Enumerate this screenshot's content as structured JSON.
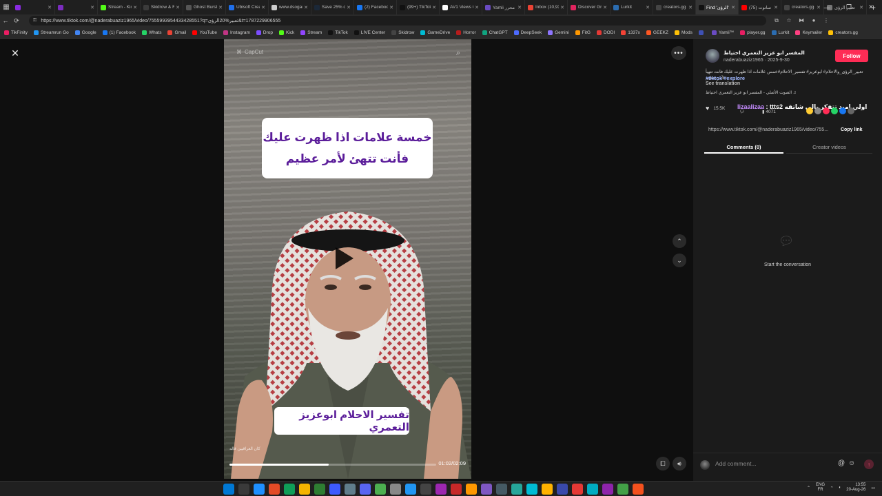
{
  "browser": {
    "tabs": [
      {
        "label": "",
        "color": "#8a2be2"
      },
      {
        "label": "",
        "color": "#7b2cbf"
      },
      {
        "label": "Stream - Kick",
        "color": "#53fc18"
      },
      {
        "label": "Skidrow & Re",
        "color": "#3b3b3b"
      },
      {
        "label": "Ghost Bursts",
        "color": "#555555"
      },
      {
        "label": "Ubisoft Crea",
        "color": "#1f6feb"
      },
      {
        "label": "www.dsogam",
        "color": "#cccccc"
      },
      {
        "label": "Save 25% on",
        "color": "#1b2838"
      },
      {
        "label": "(2) Facebook",
        "color": "#1877f2"
      },
      {
        "label": "(99+) TikTok",
        "color": "#111111"
      },
      {
        "label": "AV1 Views C",
        "color": "#ffffff"
      },
      {
        "label": "Yamli محرر",
        "color": "#6a4bc2"
      },
      {
        "label": "Inbox (10,93",
        "color": "#ea4335"
      },
      {
        "label": "Discover Gr",
        "color": "#e0245e"
      },
      {
        "label": "Lurkit",
        "color": "#2b6cb0"
      },
      {
        "label": "creators.gg",
        "color": "#444444"
      },
      {
        "label": "Find 'الرؤى'",
        "color": "#111111"
      },
      {
        "label": "(75) ساتوت",
        "color": "#ff0000"
      },
      {
        "label": "creators.gg",
        "color": "#444444"
      },
      {
        "label": "تعبير الرؤى",
        "color": "#777777"
      }
    ],
    "active_tab_index": 16,
    "url": "https://www.tiktok.com/@naderabuaziz1965/video/7555993954433428551?q=تعبير%20الرؤى&t=1787229906555",
    "bookmarks": [
      {
        "label": "TikFinity",
        "color": "#e91e63"
      },
      {
        "label": "Streamrun Go",
        "color": "#2196f3"
      },
      {
        "label": "Google",
        "color": "#4285f4"
      },
      {
        "label": "(1) Facebook",
        "color": "#1877f2"
      },
      {
        "label": "Whats",
        "color": "#25d366"
      },
      {
        "label": "Gmail",
        "color": "#ea4335"
      },
      {
        "label": "YouTube",
        "color": "#ff0000"
      },
      {
        "label": "Instagram",
        "color": "#c13584"
      },
      {
        "label": "Drop",
        "color": "#7c4dff"
      },
      {
        "label": "Kick",
        "color": "#53fc18"
      },
      {
        "label": "Stream",
        "color": "#9146ff"
      },
      {
        "label": "TikTok",
        "color": "#111111"
      },
      {
        "label": "LIVE Center",
        "color": "#111111"
      },
      {
        "label": "Skidrow",
        "color": "#444444"
      },
      {
        "label": "GameDrive",
        "color": "#00bcd4"
      },
      {
        "label": "Horror",
        "color": "#b71c1c"
      },
      {
        "label": "ChatGPT",
        "color": "#10a37f"
      },
      {
        "label": "DeepSeek",
        "color": "#4d6bfe"
      },
      {
        "label": "Gemini",
        "color": "#8e75ff"
      },
      {
        "label": "FitG",
        "color": "#ff9800"
      },
      {
        "label": "DODI",
        "color": "#e53935"
      },
      {
        "label": "1337x",
        "color": "#f44336"
      },
      {
        "label": "GEEKZ",
        "color": "#ff5722"
      },
      {
        "label": "Mods",
        "color": "#ffc107"
      },
      {
        "label": "",
        "color": "#3f51b5"
      },
      {
        "label": "Yamli™",
        "color": "#6a4bc2"
      },
      {
        "label": "player.gg",
        "color": "#e91e63"
      },
      {
        "label": "Lurkit",
        "color": "#2b6cb0"
      },
      {
        "label": "Keymailer",
        "color": "#ff4081"
      },
      {
        "label": "creators.gg",
        "color": "#ffc107"
      }
    ]
  },
  "video": {
    "watermark": "CapCut",
    "caption_top_line1": "خمسة علامات اذا ظهرت عليك",
    "caption_top_line2": "فأنت تتهئ لأمر عظيم",
    "caption_bottom": "تفسير الاحلام ابوعزيز التعمري",
    "handle_tag": "كان العراقيين قاله",
    "timecode": "01:02/02:09",
    "progress": 0.48
  },
  "sidebar": {
    "author_name": "المفسر ابو عزيز التعمري احتياط",
    "author_handle": "naderabuaziz1965",
    "post_date": "2025-9-30",
    "follow_label": "Follow",
    "description": "تعبير_الرؤى_والاحلام# ابوعزيز# تفسير_الاحلام#خمس علامات اذا ظهرت عليك فانت تتهيأ لأمر عظيم",
    "tags": "#tiktok #explore",
    "see_translation": "See translation",
    "music": "♫ الصوت الأصلي - المفسر ابو عزيز التعمري احتياط",
    "likes": "15.5K",
    "comments_count": "4071",
    "live_comment_nick": "lizaalizaa",
    "live_comment_text": ": ttts2 اولي اميد تتفكر بالي شاتقه",
    "share_link": "https://www.tiktok.com/@naderabuaziz1965/video/755...",
    "copy_link": "Copy link",
    "tab_comments": "Comments (0)",
    "tab_creator": "Creator videos",
    "empty_text": "Start the conversation",
    "comment_placeholder": "Add comment..."
  },
  "taskbar": {
    "lang_top": "ENG",
    "lang_bottom": "FR",
    "time": "13:55",
    "date": "20-Aug-26"
  },
  "colors": {
    "accent": "#fe2c55",
    "caption_text": "#5b1d9a"
  }
}
